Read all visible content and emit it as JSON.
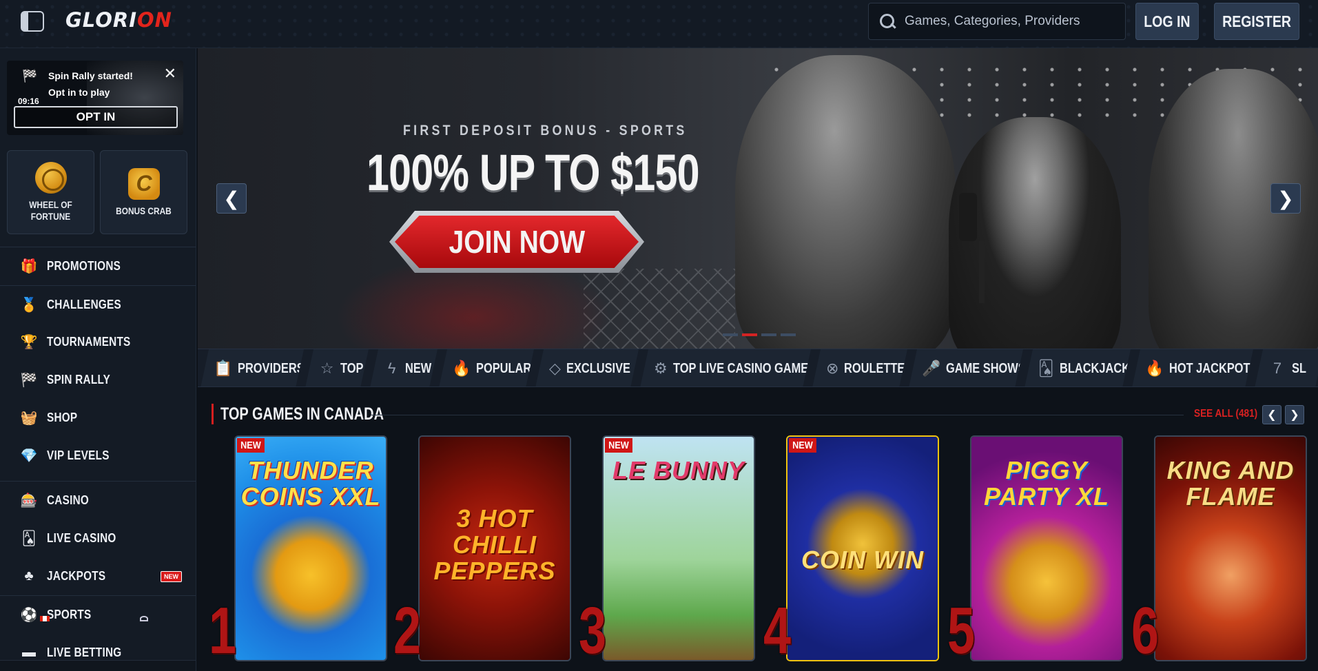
{
  "header": {
    "logo": {
      "main": "GLORI",
      "accent": "ON"
    },
    "search_placeholder": "Games, Categories, Providers",
    "login_label": "LOG IN",
    "register_label": "REGISTER"
  },
  "sidebar": {
    "notification": {
      "title": "Spin Rally started!",
      "subtitle": "Opt in to play",
      "time": "09:16",
      "button": "OPT IN",
      "close": "✕"
    },
    "tiles": [
      {
        "label": "WHEEL OF FORTUNE",
        "icon": "wheel-icon"
      },
      {
        "label": "BONUS CRAB",
        "icon": "crab-icon"
      }
    ],
    "group1": [
      {
        "label": "PROMOTIONS",
        "icon": "gift-icon",
        "glyph": "🎁"
      },
      {
        "label": "CHALLENGES",
        "icon": "medal-icon",
        "glyph": "🏅"
      },
      {
        "label": "TOURNAMENTS",
        "icon": "podium-icon",
        "glyph": "🏆"
      },
      {
        "label": "SPIN RALLY",
        "icon": "checkered-flag-icon",
        "glyph": "🏁"
      },
      {
        "label": "SHOP",
        "icon": "basket-icon",
        "glyph": "🧺"
      },
      {
        "label": "VIP LEVELS",
        "icon": "diamond-icon",
        "glyph": "💎"
      }
    ],
    "group2": [
      {
        "label": "CASINO",
        "icon": "slot-machine-icon",
        "glyph": "🎰"
      },
      {
        "label": "LIVE CASINO",
        "icon": "cards-icon",
        "glyph": "🂡"
      },
      {
        "label": "JACKPOTS",
        "icon": "clover-icon",
        "glyph": "♣",
        "badge": "NEW"
      }
    ],
    "group3": [
      {
        "label": "SPORTS",
        "icon": "soccer-ball-icon",
        "glyph": "⚽"
      },
      {
        "label": "LIVE BETTING",
        "icon": "live-icon",
        "glyph": "▬"
      }
    ]
  },
  "hero": {
    "subtitle": "FIRST DEPOSIT BONUS - SPORTS",
    "title": "100% UP TO $150",
    "cta": "JOIN NOW",
    "prev": "❮",
    "next": "❯"
  },
  "categories": [
    {
      "label": "PROVIDERS",
      "glyph": "📋"
    },
    {
      "label": "TOP",
      "glyph": "☆"
    },
    {
      "label": "NEW",
      "glyph": "ϟ"
    },
    {
      "label": "POPULAR",
      "glyph": "🔥"
    },
    {
      "label": "EXCLUSIVE",
      "glyph": "◇"
    },
    {
      "label": "TOP LIVE CASINO GAMES",
      "glyph": "⚙"
    },
    {
      "label": "ROULETTE",
      "glyph": "⊗"
    },
    {
      "label": "GAME SHOWS",
      "glyph": "🎤"
    },
    {
      "label": "BLACKJACK",
      "glyph": "🂡"
    },
    {
      "label": "HOT JACKPOTS",
      "glyph": "🔥"
    },
    {
      "label": "SL",
      "glyph": "7"
    }
  ],
  "games_section": {
    "title": "TOP GAMES IN CANADA",
    "see_all": "SEE ALL (481)",
    "prev": "❮",
    "next": "❯",
    "games": [
      {
        "rank": "1",
        "name": "THUNDER COINS XXL",
        "new": "NEW"
      },
      {
        "rank": "2",
        "name": "3 HOT CHILLI PEPPERS",
        "new": ""
      },
      {
        "rank": "3",
        "name": "LE BUNNY",
        "new": "NEW"
      },
      {
        "rank": "4",
        "name": "COIN WIN",
        "new": "NEW"
      },
      {
        "rank": "5",
        "name": "PIGGY PARTY XL",
        "new": ""
      },
      {
        "rank": "6",
        "name": "KING AND FLAME",
        "new": ""
      }
    ]
  },
  "colors": {
    "accent_red": "#d51f1f",
    "background": "#0d1219",
    "sidebar": "#141b25",
    "button": "#2b3a4f"
  }
}
